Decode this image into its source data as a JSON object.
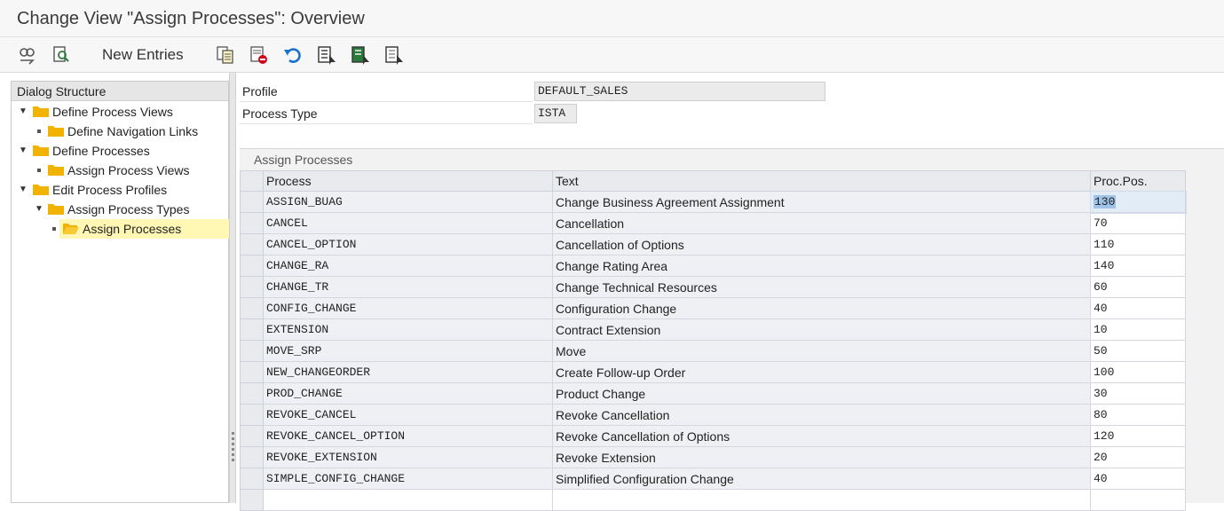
{
  "window": {
    "title": "Change View \"Assign Processes\": Overview"
  },
  "toolbar": {
    "new_entries_label": "New Entries",
    "icons": [
      "display-change-icon",
      "find-icon",
      "copy-icon",
      "delete-icon",
      "undo-icon",
      "select-all-icon",
      "select-block-icon",
      "deselect-all-icon"
    ]
  },
  "dialog_structure": {
    "header": "Dialog Structure",
    "items": [
      {
        "label": "Define Process Views",
        "level": 0,
        "expanded": true
      },
      {
        "label": "Define Navigation Links",
        "level": 1
      },
      {
        "label": "Define Processes",
        "level": 0,
        "expanded": true
      },
      {
        "label": "Assign Process Views",
        "level": 1
      },
      {
        "label": "Edit Process Profiles",
        "level": 0,
        "expanded": true
      },
      {
        "label": "Assign Process Types",
        "level": 1,
        "expanded": true
      },
      {
        "label": "Assign Processes",
        "level": 2,
        "selected": true
      }
    ]
  },
  "header_fields": {
    "profile_label": "Profile",
    "profile_value": "DEFAULT_SALES",
    "process_type_label": "Process Type",
    "process_type_value": "ISTA"
  },
  "section": {
    "title": "Assign Processes"
  },
  "table": {
    "columns": [
      "Process",
      "Text",
      "Proc.Pos."
    ],
    "rows": [
      {
        "process": "ASSIGN_BUAG",
        "text": "Change Business Agreement Assignment",
        "pos": "130"
      },
      {
        "process": "CANCEL",
        "text": "Cancellation",
        "pos": "70"
      },
      {
        "process": "CANCEL_OPTION",
        "text": "Cancellation of Options",
        "pos": "110"
      },
      {
        "process": "CHANGE_RA",
        "text": "Change Rating Area",
        "pos": "140"
      },
      {
        "process": "CHANGE_TR",
        "text": "Change Technical Resources",
        "pos": "60"
      },
      {
        "process": "CONFIG_CHANGE",
        "text": "Configuration Change",
        "pos": "40"
      },
      {
        "process": "EXTENSION",
        "text": "Contract Extension",
        "pos": "10"
      },
      {
        "process": "MOVE_SRP",
        "text": "Move",
        "pos": "50"
      },
      {
        "process": "NEW_CHANGEORDER",
        "text": "Create Follow-up Order",
        "pos": "100"
      },
      {
        "process": "PROD_CHANGE",
        "text": "Product Change",
        "pos": "30"
      },
      {
        "process": "REVOKE_CANCEL",
        "text": "Revoke Cancellation",
        "pos": "80"
      },
      {
        "process": "REVOKE_CANCEL_OPTION",
        "text": "Revoke Cancellation of Options",
        "pos": "120"
      },
      {
        "process": "REVOKE_EXTENSION",
        "text": "Revoke Extension",
        "pos": "20"
      },
      {
        "process": "SIMPLE_CONFIG_CHANGE",
        "text": "Simplified Configuration Change",
        "pos": "40"
      }
    ]
  },
  "colors": {
    "selected_tree_bg": "#fff7b3",
    "folder": "#f2b200",
    "focus_cell": "#e1ecf7",
    "focus_corner": "#d0021b"
  }
}
